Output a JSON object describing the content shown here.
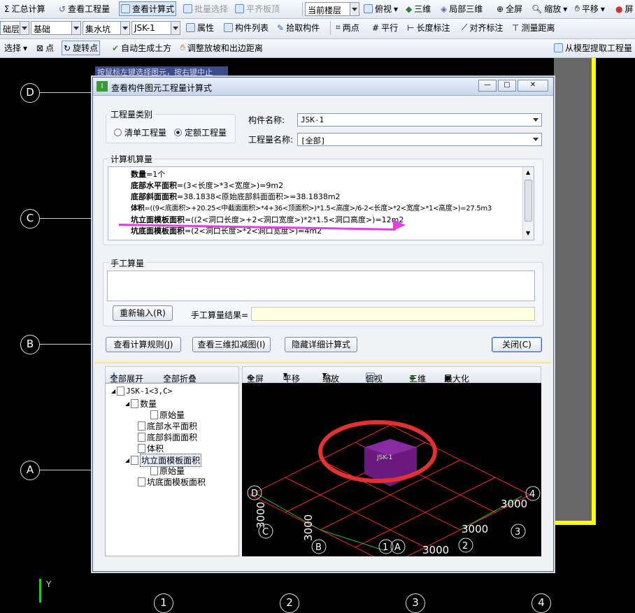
{
  "toolbar1": {
    "sum_calc": "汇总计算",
    "view_quantity": "查看工程量",
    "view_formula": "查看计算式",
    "batch_select": "批量选择",
    "align_slab_top": "平齐板顶",
    "floor_label": "当前楼层",
    "top_view": "俯视",
    "three_d": "三维",
    "local_3d": "局部三维",
    "fullscreen": "全屏",
    "zoom": "缩放",
    "pan": "平移",
    "screen_cut": "屏"
  },
  "toolbar2": {
    "category": "础层",
    "foundation": "基础",
    "element_type": "集水坑",
    "element_name": "JSK-1",
    "properties": "属性",
    "element_list": "构件列表",
    "pick_element": "拾取构件",
    "two_points": "两点",
    "parallel": "平行",
    "length_dim": "长度标注",
    "align_dim": "对齐标注",
    "measure_dist": "测量距离"
  },
  "toolbar3": {
    "select": "选择",
    "point": "点",
    "rotate_point": "旋转点",
    "auto_earthwork": "自动生成土方",
    "adjust_slope": "调整放坡和出边距离",
    "extract_from_model": "从模型提取工程量"
  },
  "canvas": {
    "hint": "按鼠标左键选择图元，按右键中止",
    "axis_labels": [
      "D",
      "C",
      "B",
      "A"
    ],
    "bottom_axis": [
      "1",
      "2",
      "3",
      "4"
    ],
    "y_label": "Y"
  },
  "dialog": {
    "title": "查看构件图元工程量计算式",
    "qty_type_label": "工程量类别",
    "radio_list": "清单工程量",
    "radio_quota": "定额工程量",
    "element_name_label": "构件名称:",
    "element_name_value": "JSK-1",
    "qty_name_label": "工程量名称:",
    "qty_name_value": "[全部]",
    "computer_calc_label": "计算机算量",
    "formula_lines": [
      {
        "name": "数量",
        "expr": "=1个"
      },
      {
        "name": "底部水平面积",
        "expr": "=(3<长度>*3<宽度>)=9m2"
      },
      {
        "name": "底部斜面面积",
        "expr": "=38.1838<原始底部斜面面积>=38.1838m2"
      },
      {
        "name": "体积",
        "expr": "=((9<底面积>+20.25<中截面面积>*4+36<顶面积>)*1.5<高度>/6-2<长度>*2<宽度>*1<高度>)=27.5m3"
      },
      {
        "name": "坑立面模板面积",
        "expr": "=((2<洞口长度>+2<洞口宽度>)*2*1.5<洞口高度>)=12m2"
      },
      {
        "name": "坑底面模板面积",
        "expr": "=(2<洞口长度>*2<洞口宽度>)=4m2"
      }
    ],
    "manual_calc_label": "手工算量",
    "reenter_button": "重新输入(R)",
    "manual_result_label": "手工算量结果=",
    "view_rules_button": "查看计算规则(J)",
    "view_3d_deduct_button": "查看三维扣减图(I)",
    "hide_detail_button": "隐藏详细计算式",
    "close_button": "关闭(C)"
  },
  "tree_panel": {
    "expand_all": "全部展开",
    "collapse_all": "全部折叠",
    "nodes": [
      {
        "label": "JSK-1<3,C>",
        "level": 0
      },
      {
        "label": "数量",
        "level": 1
      },
      {
        "label": "原始量",
        "level": 2
      },
      {
        "label": "底部水平面积",
        "level": 1
      },
      {
        "label": "底部斜面面积",
        "level": 1
      },
      {
        "label": "体积",
        "level": 1
      },
      {
        "label": "坑立面模板面积",
        "level": 1
      },
      {
        "label": "原始量",
        "level": 2
      },
      {
        "label": "坑底面模板面积",
        "level": 1
      }
    ]
  },
  "view_panel": {
    "fullscreen": "全屏",
    "pan": "平移",
    "zoom": "缩放",
    "top_view": "俯视",
    "three_d": "三维",
    "maximize": "最大化",
    "element_label": "JSK-1",
    "dims": [
      "3000",
      "3000",
      "3000",
      "3000",
      "3000"
    ],
    "axes": [
      "D",
      "C",
      "B",
      "1",
      "A",
      "2",
      "3",
      "4"
    ]
  },
  "colors": {
    "highlight_line": "#e040e0",
    "circle_annotation": "#e53030",
    "border_yellow": "#ffff00",
    "grid_red": "#ff2020",
    "element_purple": "#7a1d8c"
  }
}
